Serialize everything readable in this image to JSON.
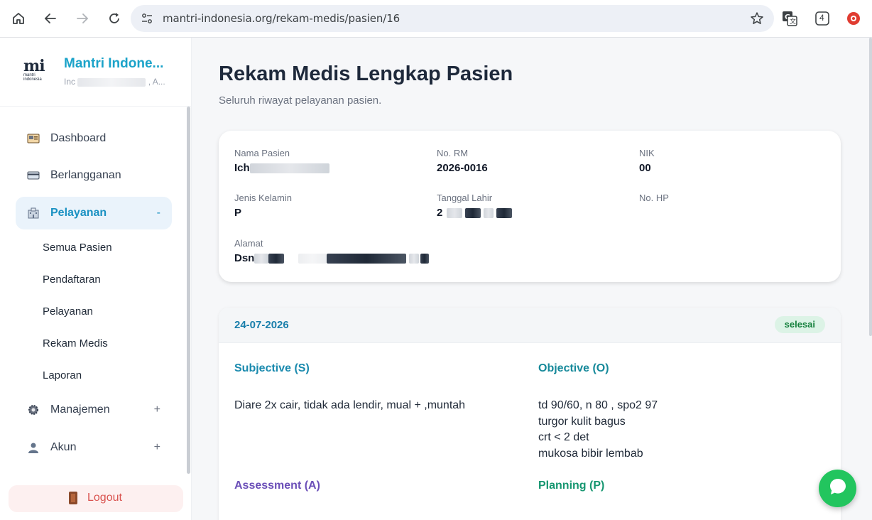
{
  "browser": {
    "url": "mantri-indonesia.org/rekam-medis/pasien/16",
    "extension_badge": "4"
  },
  "sidebar": {
    "brand_name": "Mantri Indone...",
    "brand_sub_left": "Inc",
    "brand_sub_right": ", A...",
    "logo_mark": "mi",
    "logo_text": "mantri indonesia",
    "items": [
      {
        "label": "Dashboard",
        "icon": "dashboard-icon",
        "sign": ""
      },
      {
        "label": "Berlangganan",
        "icon": "card-icon",
        "sign": ""
      },
      {
        "label": "Pelayanan",
        "icon": "hospital-icon",
        "sign": "-"
      },
      {
        "label": "Manajemen",
        "icon": "gear-icon",
        "sign": "+"
      },
      {
        "label": "Akun",
        "icon": "user-icon",
        "sign": "+"
      }
    ],
    "subitems": [
      "Semua Pasien",
      "Pendaftaran",
      "Pelayanan",
      "Rekam Medis",
      "Laporan"
    ],
    "logout_label": "Logout"
  },
  "page": {
    "title": "Rekam Medis Lengkap Pasien",
    "subtitle": "Seluruh riwayat pelayanan pasien."
  },
  "patient": {
    "name_label": "Nama Pasien",
    "name_value": "Ich",
    "rm_label": "No. RM",
    "rm_value": "2026-0016",
    "nik_label": "NIK",
    "nik_value": "00",
    "gender_label": "Jenis Kelamin",
    "gender_value": "P",
    "dob_label": "Tanggal Lahir",
    "dob_value": "2",
    "phone_label": "No. HP",
    "address_label": "Alamat",
    "address_value": "Dsn"
  },
  "visit": {
    "date": "24-07-2026",
    "status": "selesai",
    "subjective_title": "Subjective (S)",
    "subjective_text": "Diare 2x cair, tidak ada lendir, mual + ,muntah",
    "objective_title": "Objective (O)",
    "objective_text": "td 90/60, n 80 , spo2 97\nturgor kulit bagus\ncrt < 2 det\nmukosa bibir lembab",
    "assessment_title": "Assessment (A)",
    "planning_title": "Planning (P)"
  },
  "colors": {
    "brand": "#1ba3c9",
    "active": "#1a91c2",
    "badge_bg": "#dcf3e6",
    "chat": "#22c55e"
  }
}
